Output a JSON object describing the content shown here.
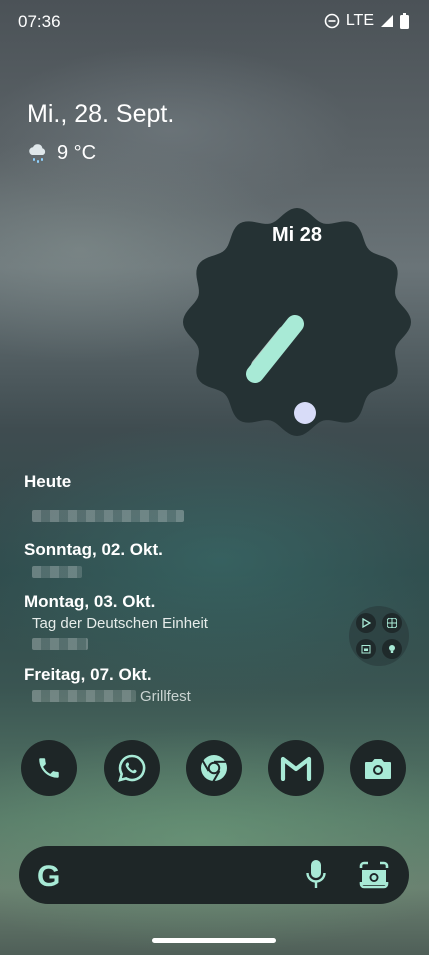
{
  "status_bar": {
    "time": "07:36",
    "network": "LTE",
    "icons": [
      "do-not-disturb-icon",
      "signal-icon",
      "battery-icon"
    ]
  },
  "at_a_glance": {
    "date": "Mi., 28. Sept.",
    "weather_icon": "rain-cloud-icon",
    "temperature": "9 °C"
  },
  "clock_widget": {
    "day_label": "Mi 28"
  },
  "agenda": {
    "sections": [
      {
        "header": "Heute",
        "item_text": ""
      },
      {
        "header": "Sonntag, 02. Okt.",
        "item_text": ""
      },
      {
        "header": "Montag, 03. Okt.",
        "item_text": "Tag der Deutschen Einheit"
      },
      {
        "header": "Freitag, 07. Okt.",
        "item_text": "Grillfest"
      }
    ]
  },
  "folder": {
    "icons": [
      "play-store-icon",
      "pinwheel-icon",
      "calendar-icon",
      "bulb-icon"
    ]
  },
  "dock": {
    "apps": [
      "phone-icon",
      "whatsapp-icon",
      "chrome-icon",
      "gmail-icon",
      "camera-icon"
    ]
  },
  "search_bar": {
    "logo": "G",
    "icons": [
      "mic-icon",
      "lens-icon"
    ]
  },
  "colors": {
    "accent": "#a8ead6",
    "clock_face": "#253234",
    "dock_bg": "#1e2627"
  }
}
